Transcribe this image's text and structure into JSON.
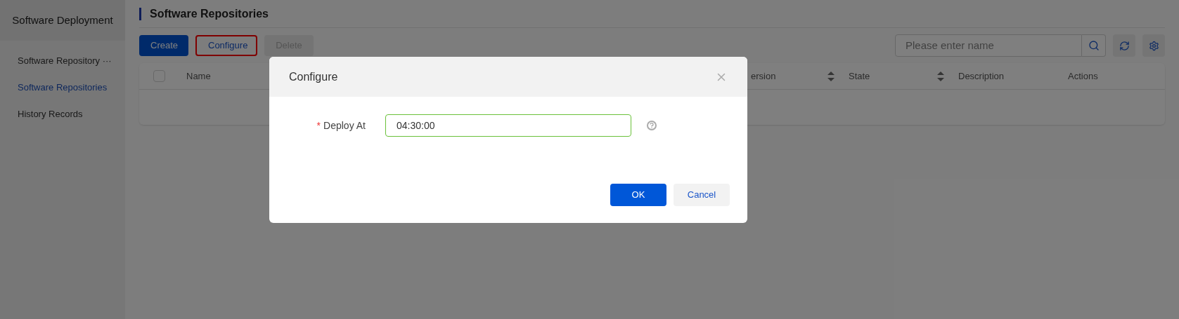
{
  "sidebar": {
    "title": "Software Deployment",
    "items": [
      {
        "label": "Software Repository ···",
        "selected": false
      },
      {
        "label": "Software Repositories",
        "selected": true
      },
      {
        "label": "History Records",
        "selected": false
      }
    ]
  },
  "page": {
    "title": "Software Repositories"
  },
  "toolbar": {
    "buttons": [
      {
        "label": "Create",
        "kind": "primary",
        "highlighted": false,
        "disabled": false
      },
      {
        "label": "Configure",
        "kind": "text",
        "highlighted": true,
        "disabled": false
      },
      {
        "label": "Delete",
        "kind": "secondary",
        "highlighted": false,
        "disabled": true
      }
    ],
    "search": {
      "placeholder": "Please enter name"
    }
  },
  "table": {
    "select_all": {
      "checked": false
    },
    "columns": [
      {
        "label": "Name",
        "sortable": false
      },
      {
        "label": "ersion",
        "sortable": true
      },
      {
        "label": "State",
        "sortable": true
      },
      {
        "label": "Description",
        "sortable": false
      },
      {
        "label": "Actions",
        "sortable": false
      }
    ]
  },
  "dialog": {
    "title": "Configure",
    "field": {
      "label": "Deploy At",
      "required_mark": "*",
      "value": "04:30:00"
    },
    "buttons": [
      {
        "label": "OK",
        "kind": "primary"
      },
      {
        "label": "Cancel",
        "kind": "secondary"
      }
    ]
  }
}
